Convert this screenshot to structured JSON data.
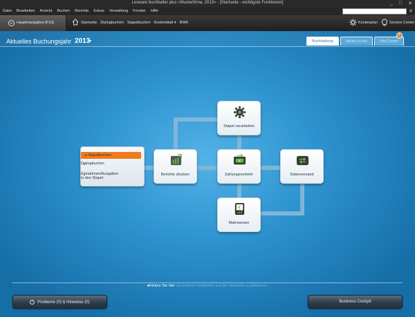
{
  "window": {
    "title": "Lexware buchhalter plus <Musterfirma, 2013> - [Startseite - wichtigste Funktionen]",
    "controls": [
      "_",
      "□",
      "✕"
    ]
  },
  "menubar": {
    "items": [
      "Datei",
      "Bearbeiten",
      "Ansicht",
      "Buchen",
      "Berichte",
      "Extras",
      "Verwaltung",
      "Fenster",
      "Hilfe"
    ],
    "search_placeholder": ""
  },
  "navbar": {
    "hauptnavigation": "Hauptnavigation [F10]",
    "links": [
      "Startseite",
      "Dialogbuchen",
      "Stapelbuchen",
      "Kontenblatt ▾",
      "BWA"
    ],
    "kontenplan": "Kontenplan",
    "service_center": "Service Center"
  },
  "header": {
    "year_label": "Aktuelles Buchungsjahr",
    "year_value": "2013",
    "year_dropdown": "▾",
    "tabs": [
      "Buchhaltung",
      "Heute zu tun",
      "Info Center"
    ],
    "active_tab": "Buchhaltung",
    "info_badge": "1"
  },
  "workflow": {
    "menu_items": [
      "Stapelbuchen",
      "Dialogbuchen",
      "Einnahmen/Ausgaben",
      "in den Stapel"
    ],
    "tiles": {
      "stapel": "Stapel verarbeiten",
      "berichte": "Berichte drucken",
      "zahlung": "Zahlungsverkehr",
      "daten": "Datenversand",
      "mahn": "Mahnwesen"
    }
  },
  "footer": {
    "hint_prefix": "Klicken Sie hier",
    "hint_rest": "um weitere Funktionen auf der Startseite zu platzieren.",
    "problems_button": "Probleme (0) & Hinweise (0)",
    "problems_icon": "!",
    "cockpit_button": "Business Cockpit"
  },
  "colors": {
    "accent": "#f07b1d",
    "background": "#2e93cf",
    "chrome": "#262626"
  }
}
